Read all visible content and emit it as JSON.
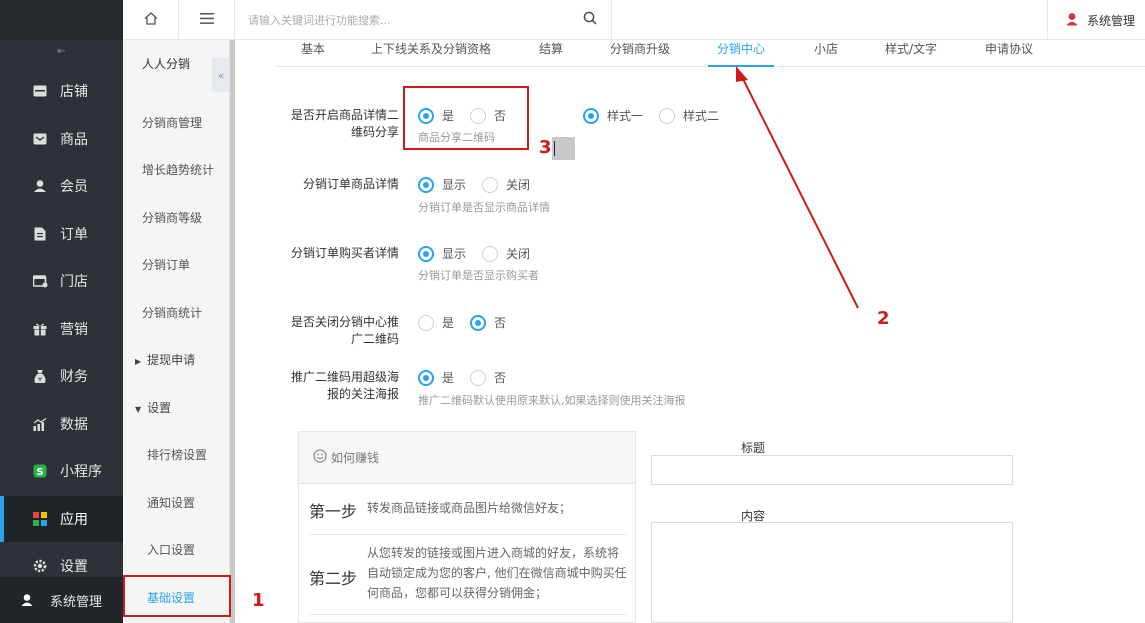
{
  "topbar": {
    "home_icon": "home-icon",
    "menu_icon": "hamburger-icon",
    "search_placeholder": "请输入关键词进行功能搜索...",
    "user_label": "系统管理"
  },
  "sidebar": {
    "collapse_glyph": "⇤",
    "items": [
      {
        "label": "店铺",
        "icon": "store-icon"
      },
      {
        "label": "商品",
        "icon": "goods-icon"
      },
      {
        "label": "会员",
        "icon": "member-icon"
      },
      {
        "label": "订单",
        "icon": "order-icon"
      },
      {
        "label": "门店",
        "icon": "shop-icon"
      },
      {
        "label": "营销",
        "icon": "gift-icon"
      },
      {
        "label": "财务",
        "icon": "finance-icon"
      },
      {
        "label": "数据",
        "icon": "chart-icon"
      },
      {
        "label": "小程序",
        "icon": "miniapp-icon"
      },
      {
        "label": "应用",
        "icon": "apps-icon"
      },
      {
        "label": "设置",
        "icon": "gear-icon"
      }
    ],
    "user": "系统管理"
  },
  "submenu": {
    "title": "人人分销",
    "items": [
      "分销商管理",
      "增长趋势统计",
      "分销商等级",
      "分销订单",
      "分销商统计"
    ],
    "group1": "提现申请",
    "group2": "设置",
    "settings": [
      "排行榜设置",
      "通知设置",
      "入口设置",
      "基础设置"
    ]
  },
  "tabs": [
    "基本",
    "上下线关系及分销资格",
    "结算",
    "分销商升级",
    "分销中心",
    "小店",
    "样式/文字",
    "申请协议"
  ],
  "form": {
    "row1": {
      "label1": "是否开启商品详情二",
      "label2": "维码分享",
      "yes": "是",
      "no": "否",
      "hint": "商品分享二维码",
      "style1": "样式一",
      "style2": "样式二"
    },
    "row2": {
      "label": "分销订单商品详情",
      "show": "显示",
      "close": "关闭",
      "hint": "分销订单是否显示商品详情"
    },
    "row3": {
      "label": "分销订单购买者详情",
      "show": "显示",
      "close": "关闭",
      "hint": "分销订单是否显示购买者"
    },
    "row4": {
      "label1": "是否关闭分销中心推",
      "label2": "广二维码",
      "yes": "是",
      "no": "否"
    },
    "row5": {
      "label1": "推广二维码用超级海",
      "label2": "报的关注海报",
      "yes": "是",
      "no": "否",
      "hint": "推广二维码默认使用原来默认,如果选择则使用关注海报"
    }
  },
  "earn": {
    "title": "如何赚钱",
    "steps": [
      {
        "title": "第一步",
        "desc": "转发商品链接或商品图片给微信好友；"
      },
      {
        "title": "第二步",
        "desc": "从您转发的链接或图片进入商城的好友，系统将自动锁定成为您的客户, 他们在微信商城中购买任何商品，您都可以获得分销佣金；"
      }
    ]
  },
  "fields": {
    "title_label": "标题",
    "content_label": "内容"
  },
  "annotations": {
    "n1": "1",
    "n2": "2",
    "n3": "3"
  },
  "colors": {
    "accent": "#29a2f0",
    "sidebar": "#2e3238",
    "annotation": "#d01a1a"
  }
}
